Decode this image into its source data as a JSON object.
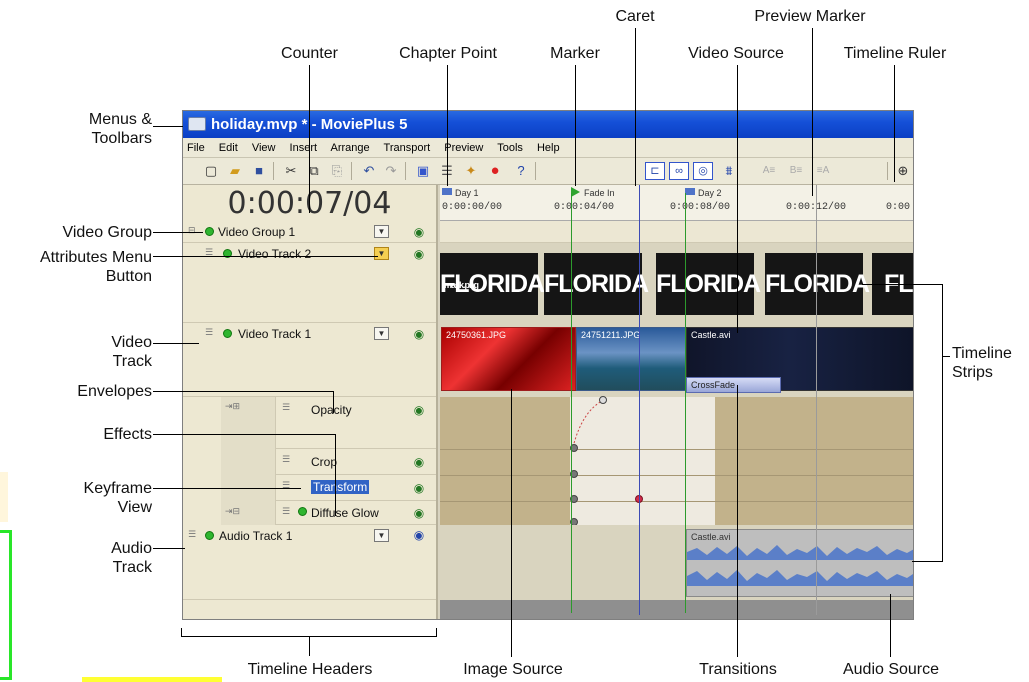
{
  "callouts": {
    "counter": "Counter",
    "chapter_point": "Chapter Point",
    "marker": "Marker",
    "caret": "Caret",
    "video_source": "Video Source",
    "preview_marker": "Preview Marker",
    "timeline_ruler": "Timeline Ruler",
    "menus_toolbars_1": "Menus &",
    "menus_toolbars_2": "Toolbars",
    "video_group": "Video Group",
    "attributes_menu_1": "Attributes Menu",
    "attributes_menu_2": "Button",
    "video_track_1": "Video",
    "video_track_2": "Track",
    "envelopes": "Envelopes",
    "effects": "Effects",
    "keyframe_1": "Keyframe",
    "keyframe_2": "View",
    "audio_track_1": "Audio",
    "audio_track_2": "Track",
    "timeline_strips_1": "Timeline",
    "timeline_strips_2": "Strips",
    "timeline_headers": "Timeline Headers",
    "image_source": "Image Source",
    "transitions": "Transitions",
    "audio_source": "Audio Source"
  },
  "app": {
    "title": "holiday.mvp * - MoviePlus 5",
    "menu": [
      "File",
      "Edit",
      "View",
      "Insert",
      "Arrange",
      "Transport",
      "Preview",
      "Tools",
      "Help"
    ],
    "counter": "0:00:07/04"
  },
  "headers": {
    "video_group": "Video Group 1",
    "video_track_2": "Video Track 2",
    "video_track_1": "Video Track 1",
    "opacity": "Opacity",
    "crop": "Crop",
    "transform": "Transform",
    "diffuse_glow": "Diffuse Glow",
    "audio_track_1": "Audio Track 1"
  },
  "ruler": {
    "chapter1": "Day 1",
    "marker": "Fade In",
    "chapter2": "Day 2",
    "t0": "0:00:00/00",
    "t1": "0:00:04/00",
    "t2": "0:00:08/00",
    "t3": "0:00:12/00",
    "t4": "0:00"
  },
  "clips": {
    "mask": "mask.png",
    "florida": "FLORIDA",
    "florida_cut": "FLO",
    "img1": "24750361.JPG",
    "img2": "24751211.JPG",
    "castle": "Castle.avi",
    "crossfade": "CrossFade",
    "audio": "Castle.avi"
  }
}
